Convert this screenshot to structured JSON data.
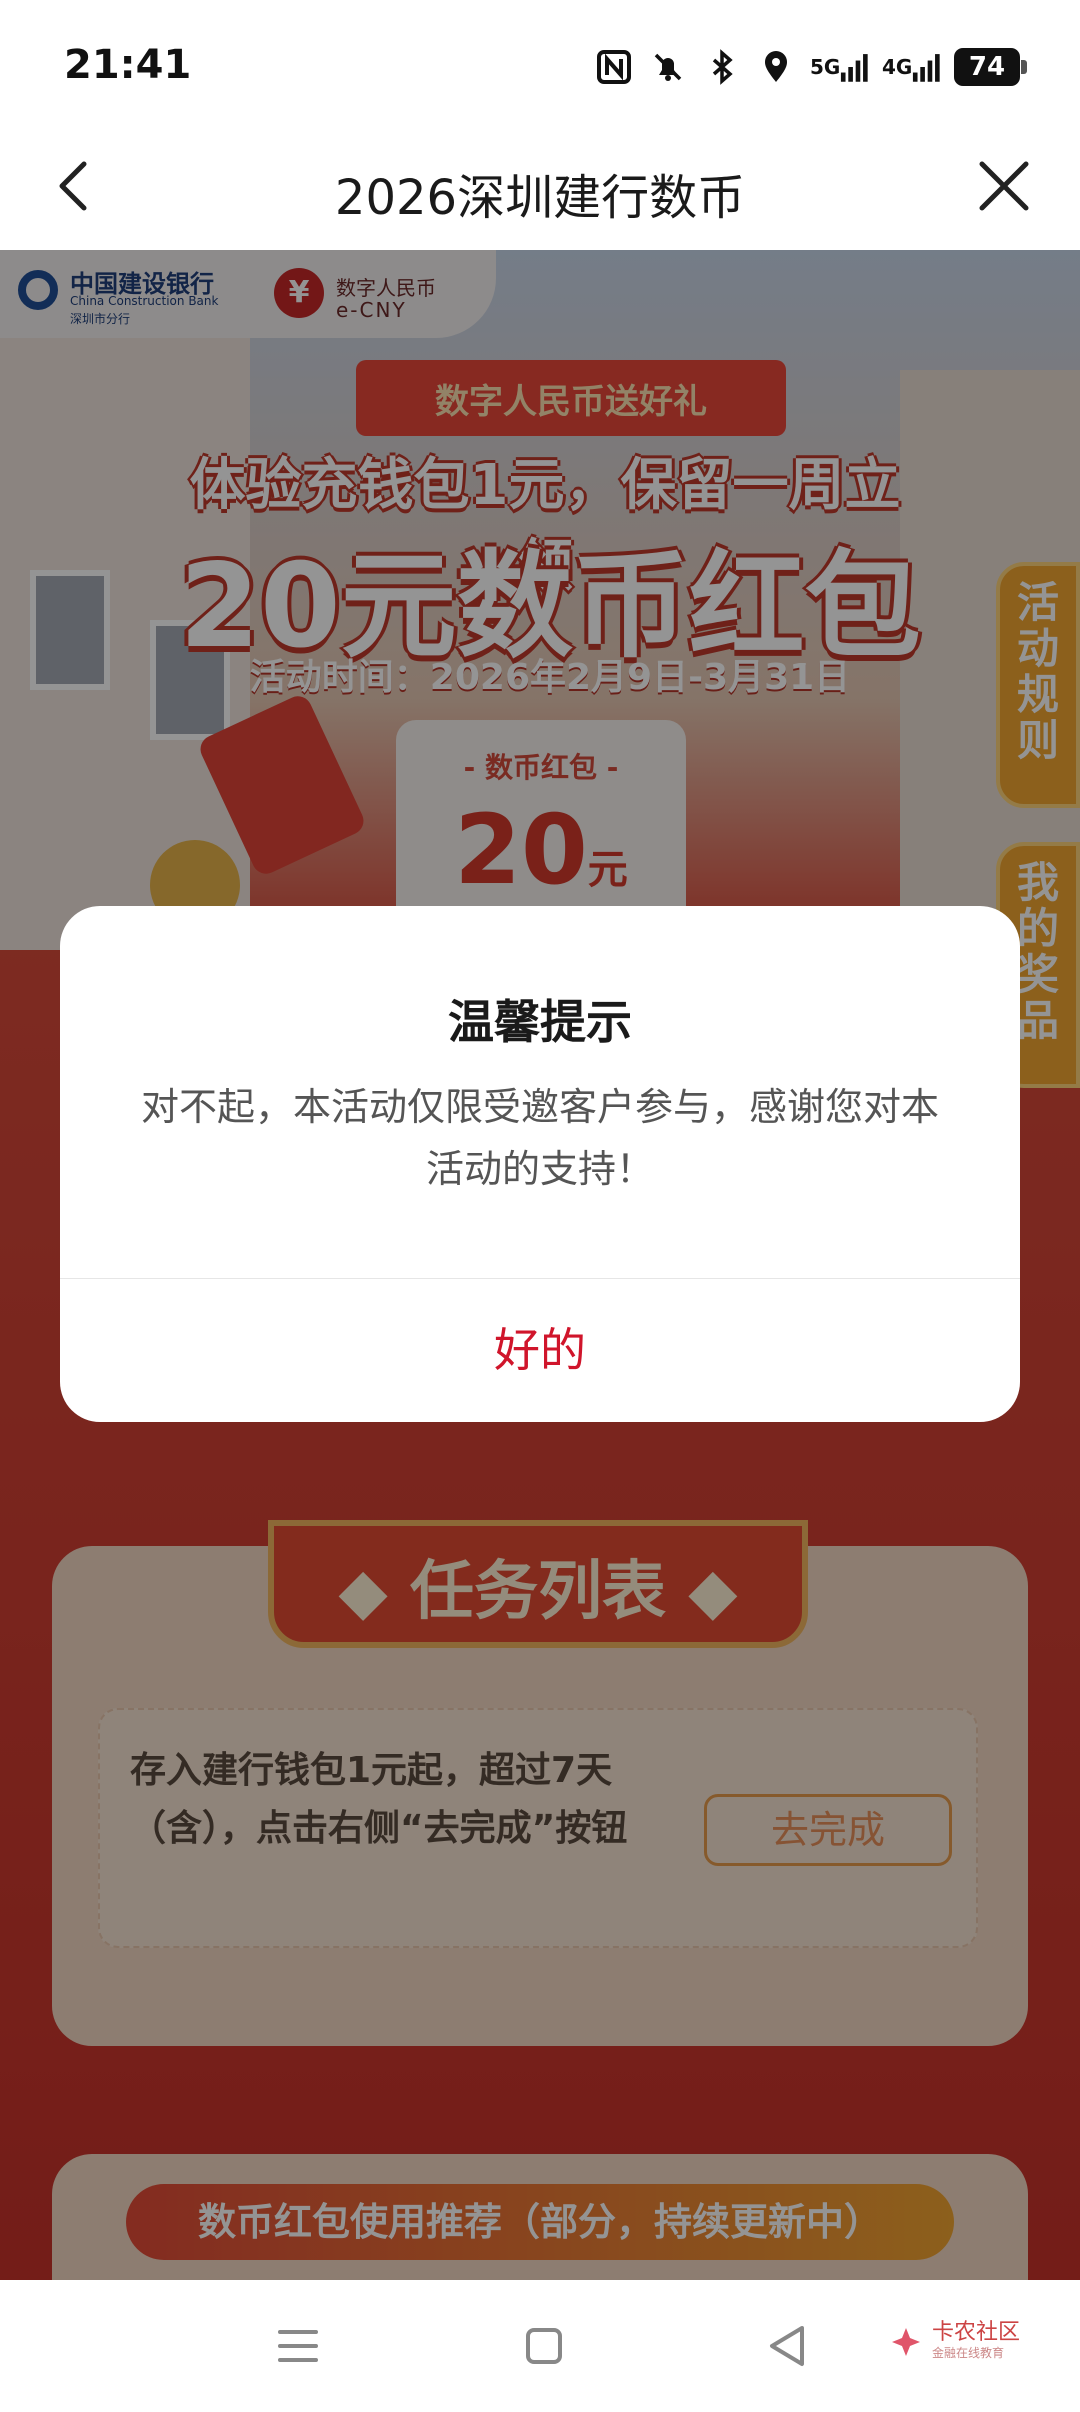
{
  "status_bar": {
    "time": "21:41",
    "net_5g": "5G",
    "net_4g": "4G",
    "battery": "74"
  },
  "titlebar": {
    "title": "2026深圳建行数币"
  },
  "banner": {
    "ccb_name": "中国建设银行",
    "ccb_en": "China Construction Bank",
    "ccb_branch": "深圳市分行",
    "ecny_symbol": "¥",
    "ecny_name": "数字人民币",
    "ecny_en": "e-CNY",
    "subtitle": "数字人民币送好礼",
    "headline_1": "体验充钱包1元，保留一周立领",
    "headline_2": "20元数币红包",
    "activity_time": "活动时间：2026年2月9日-3月31日",
    "card_label": "- 数币红包 -",
    "card_amount": "20",
    "card_unit": "元"
  },
  "side_tabs": {
    "rules": "活动规则",
    "prizes": "我的奖品"
  },
  "tasks": {
    "header": "◆ 任务列表 ◆",
    "items": [
      {
        "desc": "存入建行钱包1元起，超过7天（含），点击右侧“去完成”按钮",
        "button": "去完成"
      }
    ]
  },
  "recommend": {
    "label": "数币红包使用推荐（部分，持续更新中）"
  },
  "dialog": {
    "title": "温馨提示",
    "message": "对不起，本活动仅限受邀客户参与，感谢您对本活动的支持！",
    "ok_label": "好的"
  },
  "watermark": {
    "name": "卡农社区",
    "sub": "金融在线教育"
  },
  "colors": {
    "accent_red": "#d0152b",
    "banner_red": "#e24a33",
    "orange": "#f2a531"
  }
}
